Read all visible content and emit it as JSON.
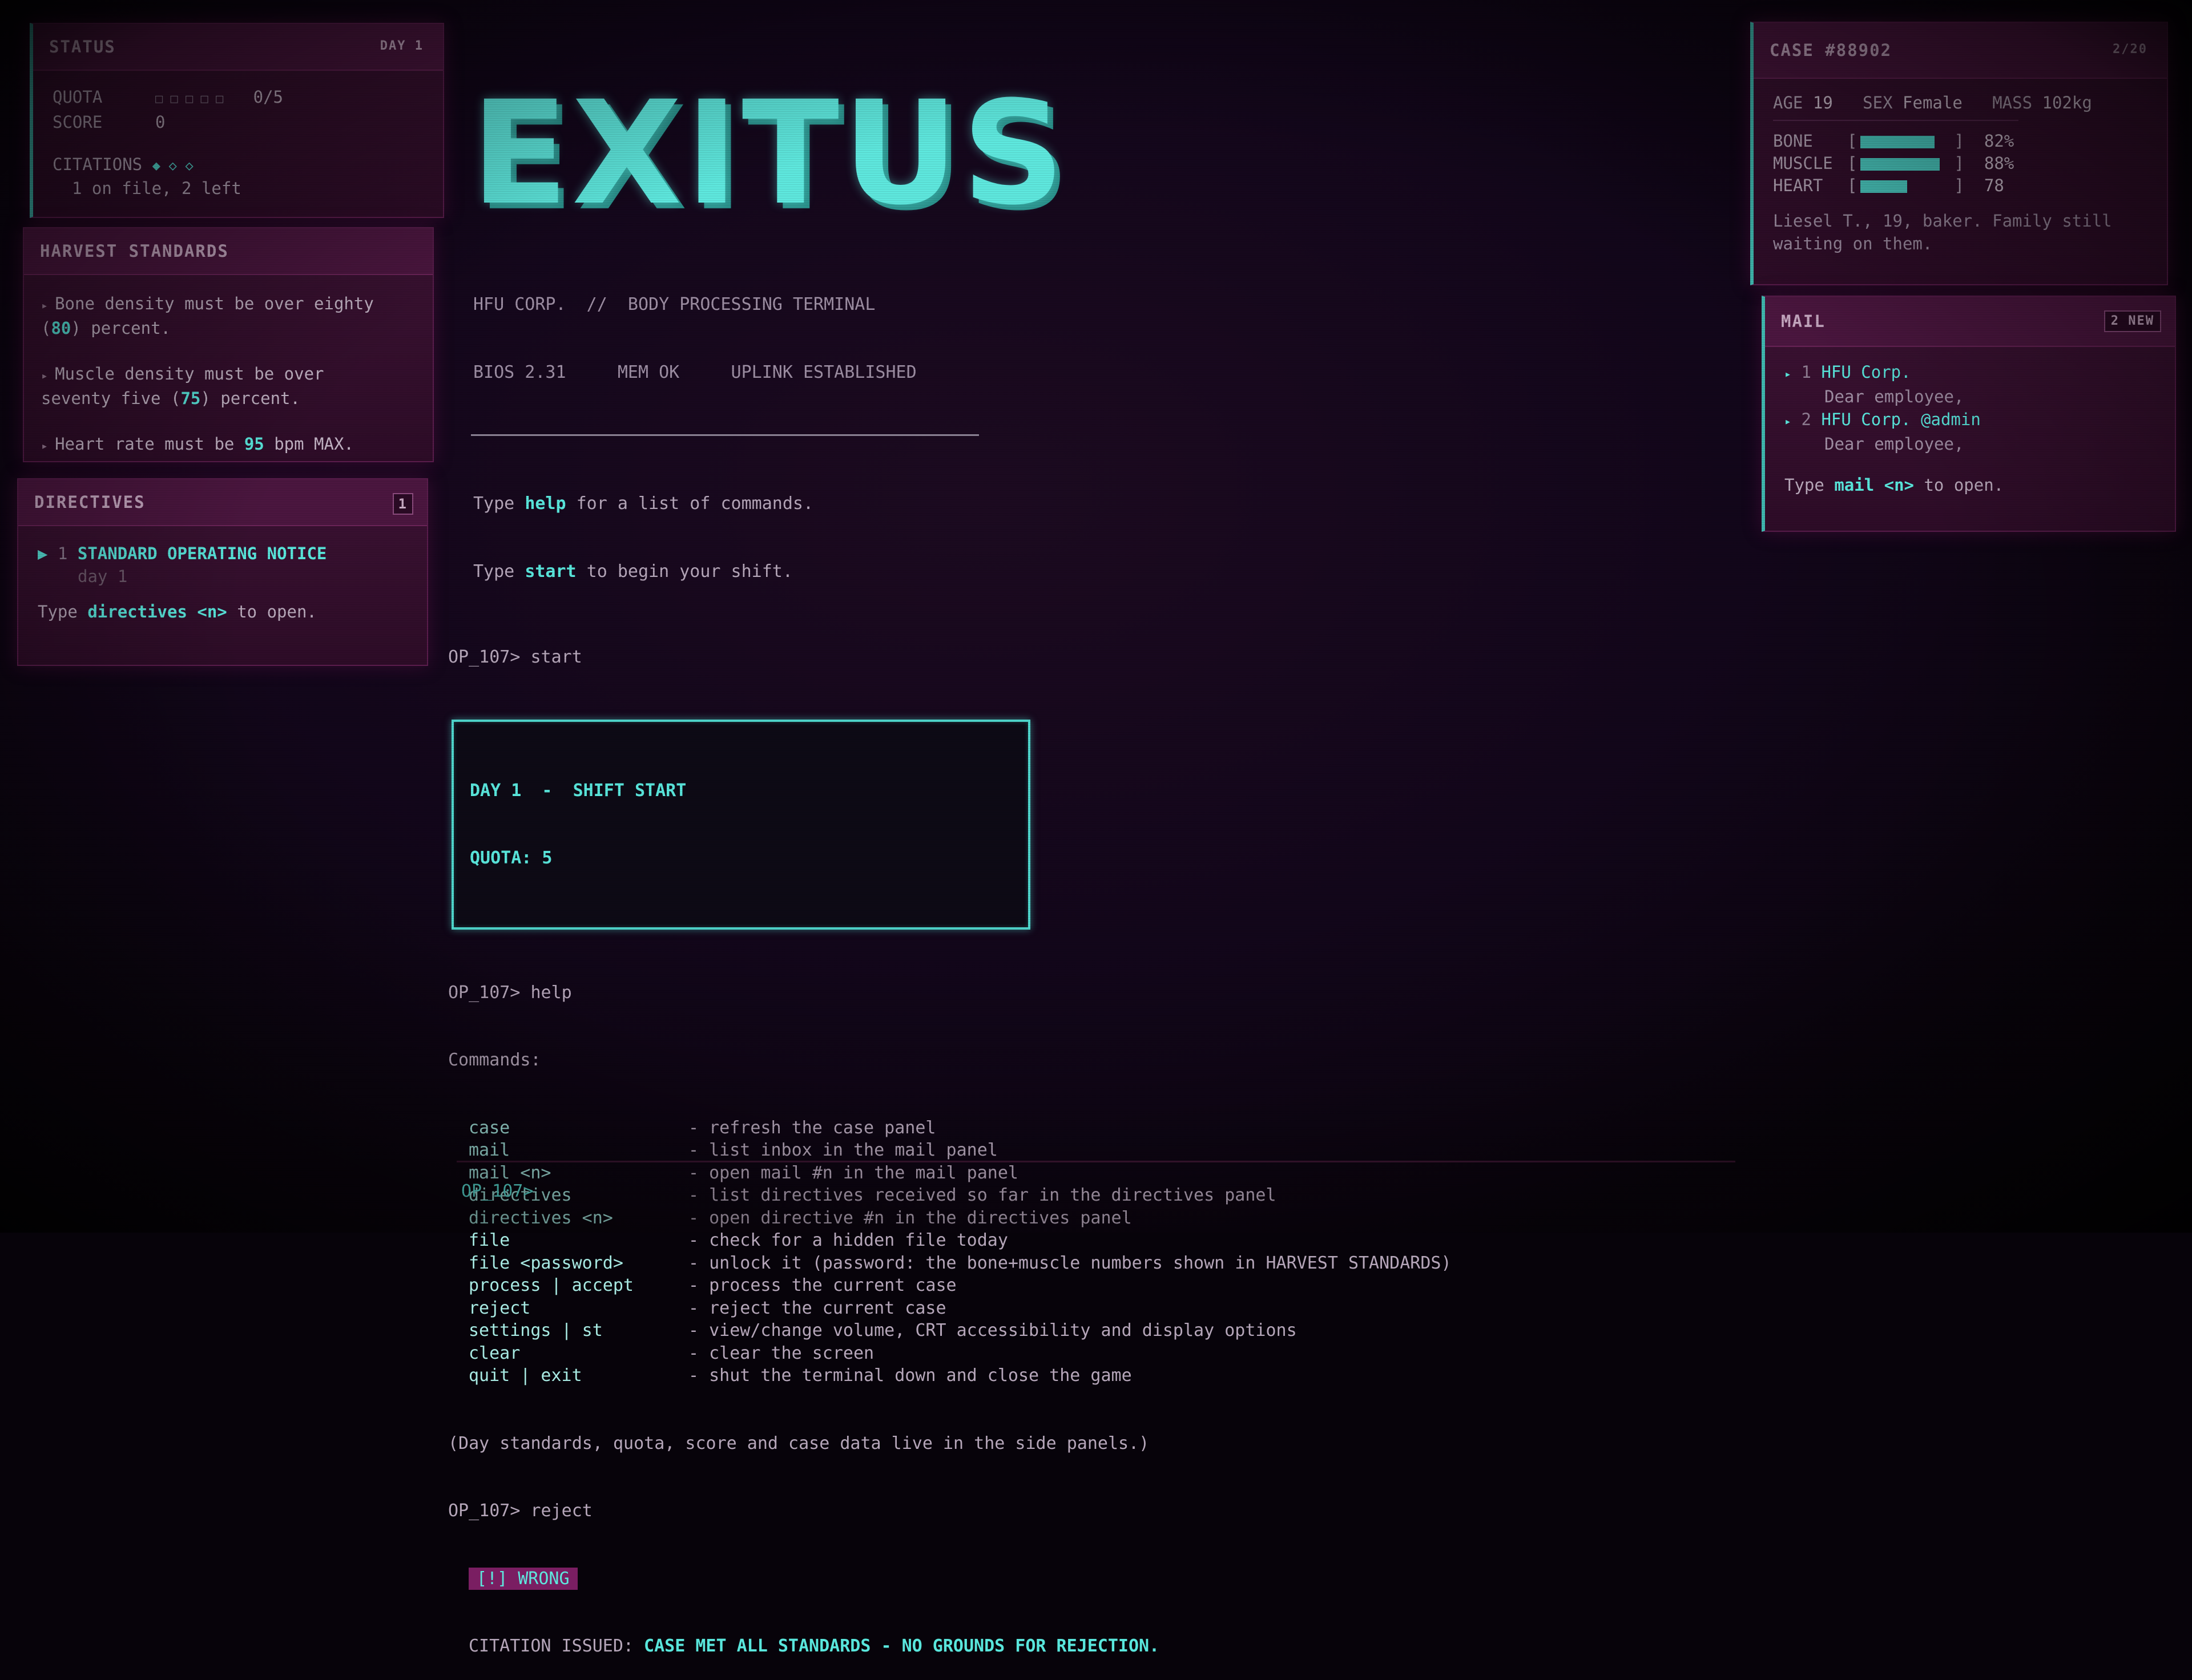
{
  "status": {
    "title": "STATUS",
    "day_badge": "DAY 1",
    "quota_label": "QUOTA",
    "quota_boxes": "□ □ □ □ □",
    "quota_value": "0/5",
    "score_label": "SCORE",
    "score_value": "0",
    "citations_label": "CITATIONS",
    "citations_marks": "◆ ◇ ◇",
    "citations_note": "1 on file, 2 left"
  },
  "harvest": {
    "title": "HARVEST STANDARDS",
    "items": [
      {
        "pre": "Bone density must be over eighty",
        "line2_pre": "(",
        "hl": "80",
        "line2_post": ") percent."
      },
      {
        "pre": "Muscle density must be over",
        "line2_pre": "seventy five (",
        "hl": "75",
        "line2_post": ") percent."
      },
      {
        "pre": "Heart rate must be ",
        "hl": "95",
        "post": " bpm MAX."
      }
    ]
  },
  "directives": {
    "title": "DIRECTIVES",
    "count_badge": "1",
    "item_num": "1",
    "item_title": "STANDARD OPERATING NOTICE",
    "item_sub": "day 1",
    "hint_pre": "Type ",
    "hint_cmd": "directives <n>",
    "hint_post": " to open."
  },
  "terminal": {
    "logo": "EXITUS",
    "sub1": "HFU CORP.  //  BODY PROCESSING TERMINAL",
    "sub2": "BIOS 2.31     MEM OK     UPLINK ESTABLISHED",
    "help_line_pre": "Type ",
    "help_line_cmd": "help",
    "help_line_post": " for a list of commands.",
    "start_line_pre": "Type ",
    "start_line_cmd": "start",
    "start_line_post": " to begin your shift.",
    "prompt1": "OP_107> start",
    "shift_box_line1": "DAY 1  -  SHIFT START",
    "shift_box_line2": "QUOTA: 5",
    "prompt2": "OP_107> help",
    "commands_header": "Commands:",
    "commands": [
      {
        "name": "case",
        "desc": "- refresh the case panel"
      },
      {
        "name": "mail",
        "desc": "- list inbox in the mail panel"
      },
      {
        "name": "mail <n>",
        "desc": "- open mail #n in the mail panel"
      },
      {
        "name": "directives",
        "desc": "- list directives received so far in the directives panel"
      },
      {
        "name": "directives <n>",
        "desc": "- open directive #n in the directives panel"
      },
      {
        "name": "file",
        "desc": "- check for a hidden file today"
      },
      {
        "name": "file <password>",
        "desc": "- unlock it (password: the bone+muscle numbers shown in HARVEST STANDARDS)"
      },
      {
        "name": "process | accept",
        "desc": "- process the current case"
      },
      {
        "name": "reject",
        "desc": "- reject the current case"
      },
      {
        "name": "settings | st",
        "desc": "- view/change volume, CRT accessibility and display options"
      },
      {
        "name": "clear",
        "desc": "- clear the screen"
      },
      {
        "name": "quit | exit",
        "desc": "- shut the terminal down and close the game"
      }
    ],
    "footer_note": "(Day standards, quota, score and case data live in the side panels.)",
    "prompt3": "OP_107> reject",
    "wrong_badge": "[!] WRONG",
    "citation_label": "CITATION ISSUED: ",
    "citation_text": "CASE MET ALL STANDARDS - NO GROUNDS FOR REJECTION.",
    "input_prompt": "OP_107>"
  },
  "case": {
    "title": "CASE #88902",
    "counter": "2/20",
    "age_label": "AGE",
    "age_value": "19",
    "sex_label": "SEX",
    "sex_value": "Female",
    "mass_label": "MASS",
    "mass_value": "102kg",
    "stats": [
      {
        "label": "BONE",
        "value": "82%",
        "fill": 0.82
      },
      {
        "label": "MUSCLE",
        "value": "88%",
        "fill": 0.88
      },
      {
        "label": "HEART",
        "value": "78",
        "fill": 0.52
      }
    ],
    "note_line1": "Liesel T., 19, baker. Family still",
    "note_line2": "waiting on them."
  },
  "mail": {
    "title": "MAIL",
    "new_badge": "2 NEW",
    "items": [
      {
        "num": "1",
        "from": "HFU Corp.",
        "preview": "Dear employee,"
      },
      {
        "num": "2",
        "from": "HFU Corp. @admin",
        "preview": "Dear employee,"
      }
    ],
    "hint_pre": "Type ",
    "hint_cmd": "mail <n>",
    "hint_post": " to open."
  },
  "colors": {
    "accent": "#59e6dc",
    "panel": "#3c1233",
    "panel_header": "#4b163f",
    "wrong": "#7a1e62"
  }
}
